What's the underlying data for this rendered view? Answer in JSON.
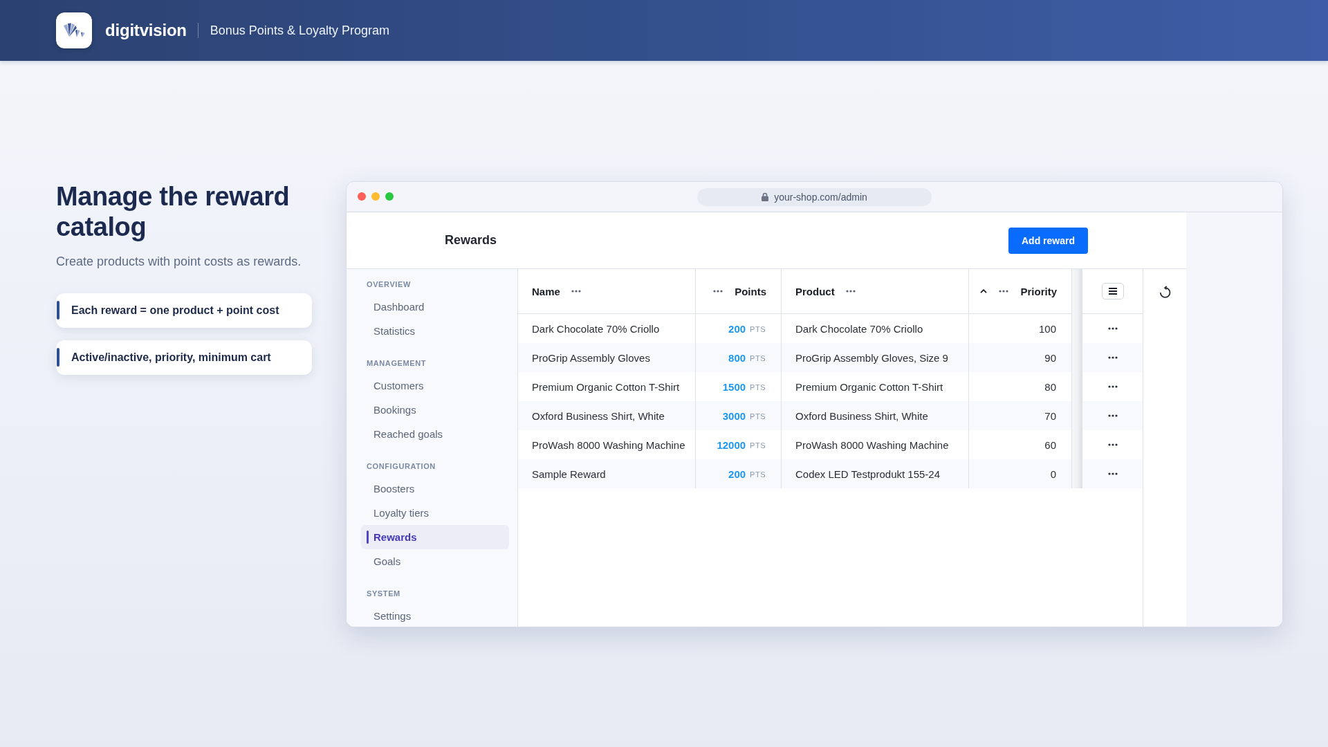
{
  "header": {
    "brand": "digitvision",
    "subtitle": "Bonus Points & Loyalty Program"
  },
  "intro": {
    "title": "Manage the reward catalog",
    "lead": "Create products with point costs as rewards.",
    "highlights": [
      "Each reward = one product + point cost",
      "Active/inactive, priority, minimum cart"
    ]
  },
  "browser": {
    "url": "your-shop.com/admin"
  },
  "app": {
    "page_title": "Rewards",
    "add_button": "Add reward",
    "sidebar": {
      "sections": [
        {
          "title": "OVERVIEW",
          "items": [
            {
              "label": "Dashboard",
              "selected": false
            },
            {
              "label": "Statistics",
              "selected": false
            }
          ]
        },
        {
          "title": "MANAGEMENT",
          "items": [
            {
              "label": "Customers",
              "selected": false
            },
            {
              "label": "Bookings",
              "selected": false
            },
            {
              "label": "Reached goals",
              "selected": false
            }
          ]
        },
        {
          "title": "CONFIGURATION",
          "items": [
            {
              "label": "Boosters",
              "selected": false
            },
            {
              "label": "Loyalty tiers",
              "selected": false
            },
            {
              "label": "Rewards",
              "selected": true
            },
            {
              "label": "Goals",
              "selected": false
            }
          ]
        },
        {
          "title": "SYSTEM",
          "items": [
            {
              "label": "Settings",
              "selected": false
            }
          ]
        }
      ]
    },
    "table": {
      "columns": [
        {
          "label": "Name",
          "kind": "text",
          "sorted": false
        },
        {
          "label": "Points",
          "kind": "number",
          "sorted": false
        },
        {
          "label": "Product",
          "kind": "text",
          "sorted": false
        },
        {
          "label": "Priority",
          "kind": "number",
          "sorted": true
        }
      ],
      "rows": [
        {
          "name": "Dark Chocolate 70% Criollo",
          "points": "200",
          "unit": "PTS",
          "product": "Dark Chocolate 70% Criollo",
          "priority": "100"
        },
        {
          "name": "ProGrip Assembly Gloves",
          "points": "800",
          "unit": "PTS",
          "product": "ProGrip Assembly Gloves, Size 9",
          "priority": "90"
        },
        {
          "name": "Premium Organic Cotton T-Shirt",
          "points": "1500",
          "unit": "PTS",
          "product": "Premium Organic Cotton T-Shirt",
          "priority": "80"
        },
        {
          "name": "Oxford Business Shirt, White",
          "points": "3000",
          "unit": "PTS",
          "product": "Oxford Business Shirt, White",
          "priority": "70"
        },
        {
          "name": "ProWash 8000 Washing Machine",
          "points": "12000",
          "unit": "PTS",
          "product": "ProWash 8000 Washing Machine",
          "priority": "60"
        },
        {
          "name": "Sample Reward",
          "points": "200",
          "unit": "PTS",
          "product": "Codex LED Testprodukt 155-24",
          "priority": "0"
        }
      ]
    }
  }
}
